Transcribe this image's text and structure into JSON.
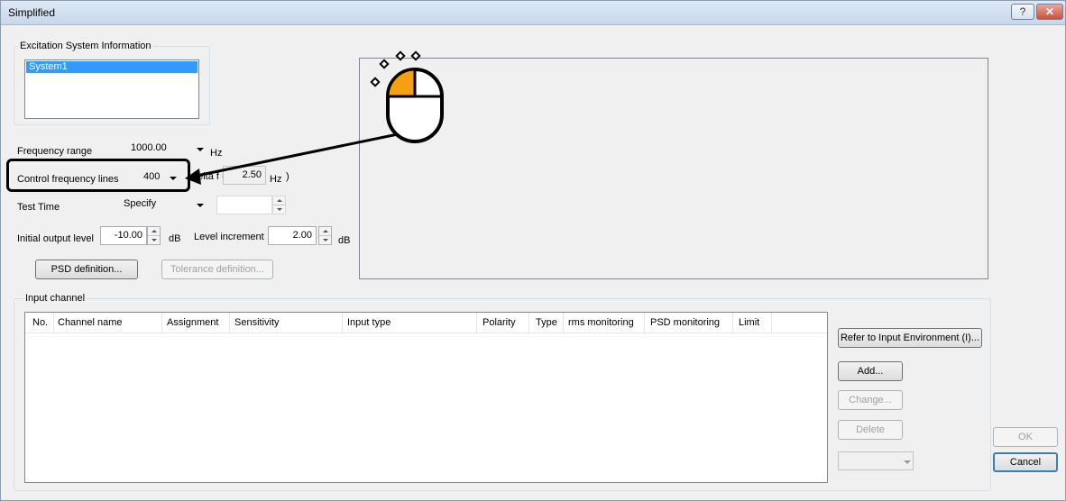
{
  "window": {
    "title": "Simplified",
    "help_button": "?",
    "close_button": "✕"
  },
  "excitation": {
    "group_label": "Excitation System Information",
    "systems": [
      "System1"
    ]
  },
  "frequency_range": {
    "label": "Frequency range",
    "value": "1000.00",
    "unit": "Hz"
  },
  "control_lines": {
    "label": "Control frequency lines",
    "value": "400",
    "delta_label": "delta f =",
    "delta_value": "2.50",
    "delta_unit": "Hz",
    "close_paren": ")"
  },
  "test_time": {
    "label": "Test Time",
    "mode": "Specify",
    "value": ""
  },
  "initial_output": {
    "label": "Initial output level",
    "value": "-10.00",
    "unit": "dB"
  },
  "level_increment": {
    "label": "Level increment",
    "value": "2.00",
    "unit": "dB"
  },
  "buttons": {
    "psd_definition": "PSD definition...",
    "tolerance_definition": "Tolerance definition...",
    "refer_input_env": "Refer to Input Environment (I)...",
    "add": "Add...",
    "change": "Change...",
    "delete": "Delete",
    "ok": "OK",
    "cancel": "Cancel"
  },
  "input_channel": {
    "group_label": "Input channel",
    "columns": [
      "No.",
      "Channel name",
      "Assignment",
      "Sensitivity",
      "Input type",
      "Polarity",
      "Type",
      "rms monitoring",
      "PSD monitoring",
      "Limit"
    ],
    "rows": []
  },
  "channel_combo": {
    "value": ""
  }
}
